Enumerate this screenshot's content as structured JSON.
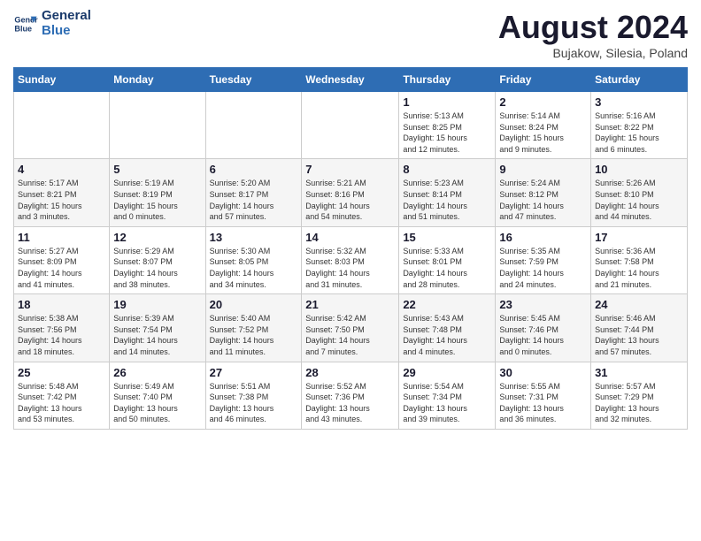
{
  "header": {
    "logo_line1": "General",
    "logo_line2": "Blue",
    "month_year": "August 2024",
    "location": "Bujakow, Silesia, Poland"
  },
  "weekdays": [
    "Sunday",
    "Monday",
    "Tuesday",
    "Wednesday",
    "Thursday",
    "Friday",
    "Saturday"
  ],
  "weeks": [
    [
      {
        "day": "",
        "info": ""
      },
      {
        "day": "",
        "info": ""
      },
      {
        "day": "",
        "info": ""
      },
      {
        "day": "",
        "info": ""
      },
      {
        "day": "1",
        "info": "Sunrise: 5:13 AM\nSunset: 8:25 PM\nDaylight: 15 hours\nand 12 minutes."
      },
      {
        "day": "2",
        "info": "Sunrise: 5:14 AM\nSunset: 8:24 PM\nDaylight: 15 hours\nand 9 minutes."
      },
      {
        "day": "3",
        "info": "Sunrise: 5:16 AM\nSunset: 8:22 PM\nDaylight: 15 hours\nand 6 minutes."
      }
    ],
    [
      {
        "day": "4",
        "info": "Sunrise: 5:17 AM\nSunset: 8:21 PM\nDaylight: 15 hours\nand 3 minutes."
      },
      {
        "day": "5",
        "info": "Sunrise: 5:19 AM\nSunset: 8:19 PM\nDaylight: 15 hours\nand 0 minutes."
      },
      {
        "day": "6",
        "info": "Sunrise: 5:20 AM\nSunset: 8:17 PM\nDaylight: 14 hours\nand 57 minutes."
      },
      {
        "day": "7",
        "info": "Sunrise: 5:21 AM\nSunset: 8:16 PM\nDaylight: 14 hours\nand 54 minutes."
      },
      {
        "day": "8",
        "info": "Sunrise: 5:23 AM\nSunset: 8:14 PM\nDaylight: 14 hours\nand 51 minutes."
      },
      {
        "day": "9",
        "info": "Sunrise: 5:24 AM\nSunset: 8:12 PM\nDaylight: 14 hours\nand 47 minutes."
      },
      {
        "day": "10",
        "info": "Sunrise: 5:26 AM\nSunset: 8:10 PM\nDaylight: 14 hours\nand 44 minutes."
      }
    ],
    [
      {
        "day": "11",
        "info": "Sunrise: 5:27 AM\nSunset: 8:09 PM\nDaylight: 14 hours\nand 41 minutes."
      },
      {
        "day": "12",
        "info": "Sunrise: 5:29 AM\nSunset: 8:07 PM\nDaylight: 14 hours\nand 38 minutes."
      },
      {
        "day": "13",
        "info": "Sunrise: 5:30 AM\nSunset: 8:05 PM\nDaylight: 14 hours\nand 34 minutes."
      },
      {
        "day": "14",
        "info": "Sunrise: 5:32 AM\nSunset: 8:03 PM\nDaylight: 14 hours\nand 31 minutes."
      },
      {
        "day": "15",
        "info": "Sunrise: 5:33 AM\nSunset: 8:01 PM\nDaylight: 14 hours\nand 28 minutes."
      },
      {
        "day": "16",
        "info": "Sunrise: 5:35 AM\nSunset: 7:59 PM\nDaylight: 14 hours\nand 24 minutes."
      },
      {
        "day": "17",
        "info": "Sunrise: 5:36 AM\nSunset: 7:58 PM\nDaylight: 14 hours\nand 21 minutes."
      }
    ],
    [
      {
        "day": "18",
        "info": "Sunrise: 5:38 AM\nSunset: 7:56 PM\nDaylight: 14 hours\nand 18 minutes."
      },
      {
        "day": "19",
        "info": "Sunrise: 5:39 AM\nSunset: 7:54 PM\nDaylight: 14 hours\nand 14 minutes."
      },
      {
        "day": "20",
        "info": "Sunrise: 5:40 AM\nSunset: 7:52 PM\nDaylight: 14 hours\nand 11 minutes."
      },
      {
        "day": "21",
        "info": "Sunrise: 5:42 AM\nSunset: 7:50 PM\nDaylight: 14 hours\nand 7 minutes."
      },
      {
        "day": "22",
        "info": "Sunrise: 5:43 AM\nSunset: 7:48 PM\nDaylight: 14 hours\nand 4 minutes."
      },
      {
        "day": "23",
        "info": "Sunrise: 5:45 AM\nSunset: 7:46 PM\nDaylight: 14 hours\nand 0 minutes."
      },
      {
        "day": "24",
        "info": "Sunrise: 5:46 AM\nSunset: 7:44 PM\nDaylight: 13 hours\nand 57 minutes."
      }
    ],
    [
      {
        "day": "25",
        "info": "Sunrise: 5:48 AM\nSunset: 7:42 PM\nDaylight: 13 hours\nand 53 minutes."
      },
      {
        "day": "26",
        "info": "Sunrise: 5:49 AM\nSunset: 7:40 PM\nDaylight: 13 hours\nand 50 minutes."
      },
      {
        "day": "27",
        "info": "Sunrise: 5:51 AM\nSunset: 7:38 PM\nDaylight: 13 hours\nand 46 minutes."
      },
      {
        "day": "28",
        "info": "Sunrise: 5:52 AM\nSunset: 7:36 PM\nDaylight: 13 hours\nand 43 minutes."
      },
      {
        "day": "29",
        "info": "Sunrise: 5:54 AM\nSunset: 7:34 PM\nDaylight: 13 hours\nand 39 minutes."
      },
      {
        "day": "30",
        "info": "Sunrise: 5:55 AM\nSunset: 7:31 PM\nDaylight: 13 hours\nand 36 minutes."
      },
      {
        "day": "31",
        "info": "Sunrise: 5:57 AM\nSunset: 7:29 PM\nDaylight: 13 hours\nand 32 minutes."
      }
    ]
  ]
}
